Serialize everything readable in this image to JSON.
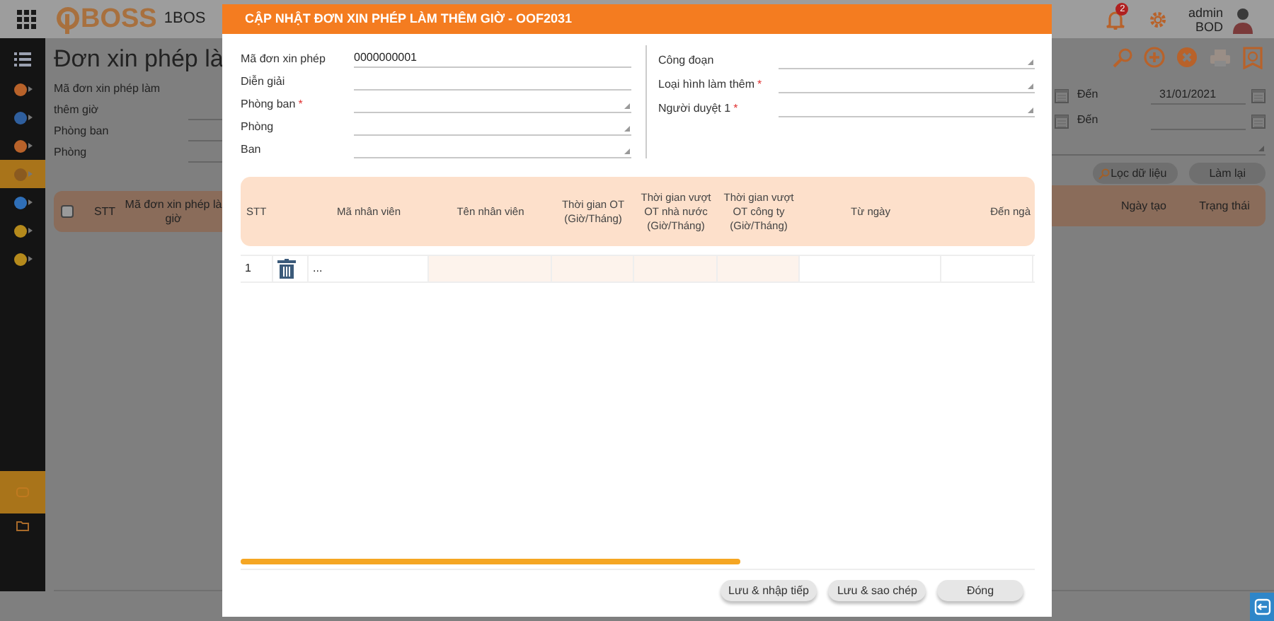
{
  "topbar": {
    "logo": "BOSS",
    "app_name": "1BOS",
    "notification_count": "2",
    "user_name": "admin",
    "user_role": "BOD"
  },
  "sidebar": {
    "items": [
      {
        "kind": "menu",
        "selected": false
      },
      {
        "kind": "dot",
        "selected": false,
        "color": "#b8622a"
      },
      {
        "kind": "dot",
        "selected": false,
        "color": "#2f5f9e"
      },
      {
        "kind": "dot",
        "selected": false,
        "color": "#b8622a"
      },
      {
        "kind": "dot",
        "selected": true,
        "color": "#8a5a20"
      },
      {
        "kind": "dot",
        "selected": false,
        "color": "#2f6fb8"
      },
      {
        "kind": "dot",
        "selected": false,
        "color": "#b58a1c"
      },
      {
        "kind": "dot",
        "selected": false,
        "color": "#b58a1c"
      }
    ],
    "bottom_items": [
      {
        "kind": "square",
        "selected": true
      },
      {
        "kind": "folder",
        "selected": false
      }
    ]
  },
  "page": {
    "title": "Đơn xin phép là",
    "select_all": {
      "checked": false
    },
    "filters": [
      {
        "label": "Mã đơn xin phép làm thêm giờ"
      },
      {
        "label": "Phòng ban"
      },
      {
        "label": "Phòng"
      }
    ],
    "toolbar": [
      {
        "kind": "search",
        "disabled": false
      },
      {
        "kind": "add",
        "disabled": false
      },
      {
        "kind": "delete",
        "disabled": false
      },
      {
        "kind": "print",
        "disabled": true
      },
      {
        "kind": "filter",
        "disabled": false
      }
    ],
    "date_filters": [
      {
        "label": "Đến",
        "value": "31/01/2021"
      },
      {
        "label": "Đến"
      }
    ],
    "filter_buttons": [
      {
        "label": "Lọc dữ liệu",
        "kind": "search"
      },
      {
        "label": "Làm lại",
        "kind": "plain"
      }
    ],
    "list_columns_left": [
      "STT",
      "Mã đơn xin phép là\ngiờ"
    ],
    "list_columns_right": [
      "Ngày tạo",
      "Trạng thái"
    ]
  },
  "modal": {
    "title": "CẬP NHẬT ĐƠN XIN PHÉP LÀM THÊM GIỜ - OOF2031",
    "fields_left": [
      {
        "label": "Mã đơn xin phép",
        "kind": "text",
        "value": "0000000001"
      },
      {
        "label": "Diễn giải",
        "kind": "text"
      },
      {
        "label": "Phòng ban",
        "mark": "*",
        "kind": "select"
      },
      {
        "label": "Phòng",
        "kind": "select"
      },
      {
        "label": "Ban",
        "kind": "select"
      }
    ],
    "fields_right": [
      {
        "label": "Công đoạn",
        "kind": "select"
      },
      {
        "label": "Loại hình làm thêm",
        "mark": "*",
        "kind": "select"
      },
      {
        "label": "Người duyệt 1",
        "mark": "*",
        "kind": "select"
      }
    ],
    "grid": {
      "columns": [
        "STT",
        "Mã nhân viên",
        "Tên nhân viên",
        "Thời gian OT (Giờ/Tháng)",
        "Thời gian vượt OT nhà nước (Giờ/Tháng)",
        "Thời gian vượt OT công ty (Giờ/Tháng)",
        "Từ ngày",
        "Đến ngà"
      ],
      "rows": [
        {
          "stt": "1",
          "employee_code": "..."
        }
      ]
    },
    "buttons": [
      "Lưu & nhập tiếp",
      "Lưu & sao chép",
      "Đóng"
    ]
  }
}
